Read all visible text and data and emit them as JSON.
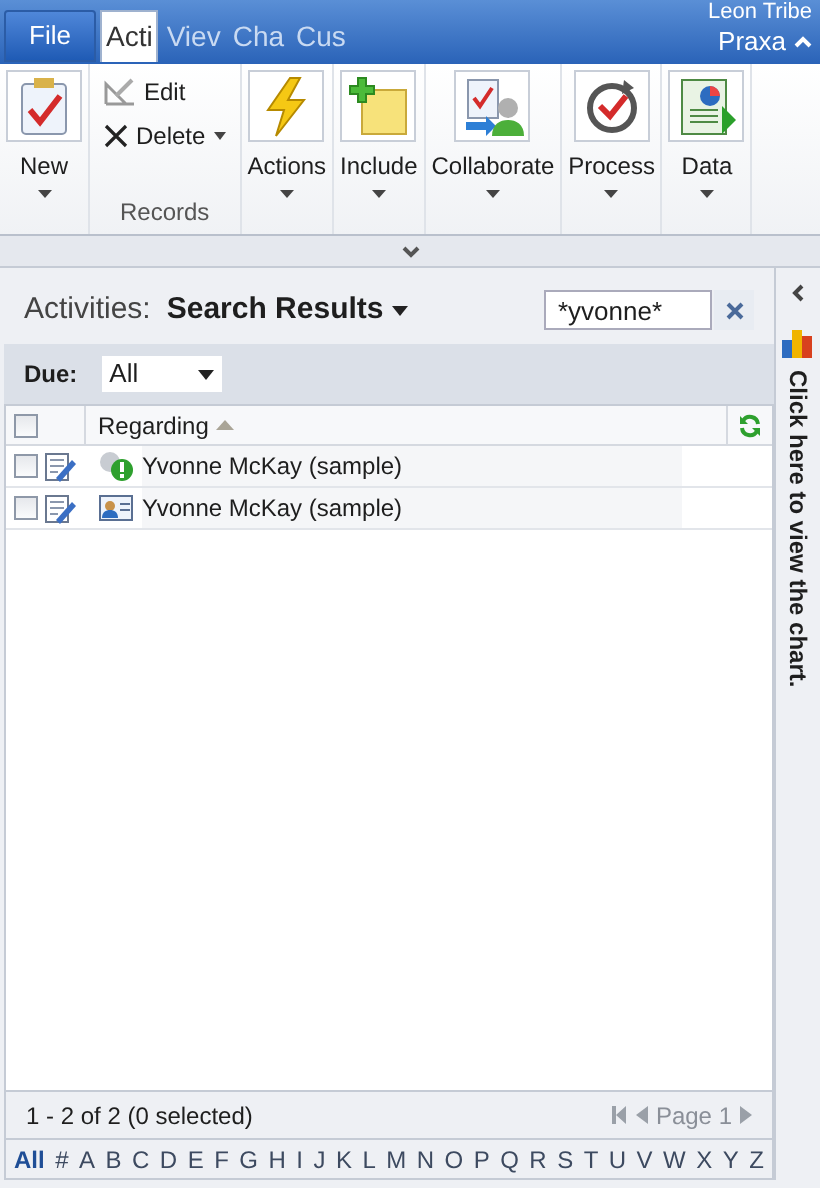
{
  "title_bar": {
    "user": "Leon Tribe",
    "organization": "Praxa"
  },
  "tabs": [
    {
      "label": "File",
      "kind": "file",
      "selected": false
    },
    {
      "label": "Acti",
      "kind": "tab",
      "selected": true
    },
    {
      "label": "Viev",
      "kind": "tab",
      "selected": false
    },
    {
      "label": "Cha",
      "kind": "tab",
      "selected": false
    },
    {
      "label": "Cus",
      "kind": "tab",
      "selected": false
    }
  ],
  "ribbon": [
    {
      "buttons": [
        {
          "label": "New",
          "kind": "large"
        }
      ]
    },
    {
      "group_label": "Records",
      "buttons": [
        {
          "label": "Edit",
          "kind": "small",
          "dropdown": false
        },
        {
          "label": "Delete",
          "kind": "small",
          "dropdown": true
        }
      ]
    },
    {
      "buttons": [
        {
          "label": "Actions",
          "kind": "large"
        }
      ]
    },
    {
      "buttons": [
        {
          "label": "Include",
          "kind": "large"
        }
      ]
    },
    {
      "buttons": [
        {
          "label": "Collaborate",
          "kind": "large"
        }
      ]
    },
    {
      "buttons": [
        {
          "label": "Process",
          "kind": "large"
        }
      ]
    },
    {
      "buttons": [
        {
          "label": "Data",
          "kind": "large"
        }
      ]
    }
  ],
  "view_header": {
    "entity": "Activities:",
    "view": "Search Results",
    "search_value": "*yvonne*"
  },
  "filter": {
    "label": "Due:",
    "value": "All"
  },
  "grid": {
    "columns": [
      {
        "label": "Regarding",
        "sorted": true
      }
    ],
    "rows": [
      {
        "regarding": "Yvonne McKay (sample)",
        "checked": false,
        "kind": "alert"
      },
      {
        "regarding": "Yvonne McKay (sample)",
        "checked": false,
        "kind": "contact"
      }
    ],
    "all_checked": false
  },
  "chart_pane": {
    "label": "Click here to view the chart."
  },
  "footer": {
    "count": "1 - 2 of 2 (0 selected)",
    "page": "Page 1"
  },
  "jump_bar": [
    {
      "label": "All",
      "selected": true
    },
    {
      "label": "#",
      "selected": false
    },
    {
      "label": "A",
      "selected": false
    },
    {
      "label": "B",
      "selected": false
    },
    {
      "label": "C",
      "selected": false
    },
    {
      "label": "D",
      "selected": false
    },
    {
      "label": "E",
      "selected": false
    },
    {
      "label": "F",
      "selected": false
    },
    {
      "label": "G",
      "selected": false
    },
    {
      "label": "H",
      "selected": false
    },
    {
      "label": "I",
      "selected": false
    },
    {
      "label": "J",
      "selected": false
    },
    {
      "label": "K",
      "selected": false
    },
    {
      "label": "L",
      "selected": false
    },
    {
      "label": "M",
      "selected": false
    },
    {
      "label": "N",
      "selected": false
    },
    {
      "label": "O",
      "selected": false
    },
    {
      "label": "P",
      "selected": false
    },
    {
      "label": "Q",
      "selected": false
    },
    {
      "label": "R",
      "selected": false
    },
    {
      "label": "S",
      "selected": false
    },
    {
      "label": "T",
      "selected": false
    },
    {
      "label": "U",
      "selected": false
    },
    {
      "label": "V",
      "selected": false
    },
    {
      "label": "W",
      "selected": false
    },
    {
      "label": "X",
      "selected": false
    },
    {
      "label": "Y",
      "selected": false
    },
    {
      "label": "Z",
      "selected": false
    }
  ]
}
